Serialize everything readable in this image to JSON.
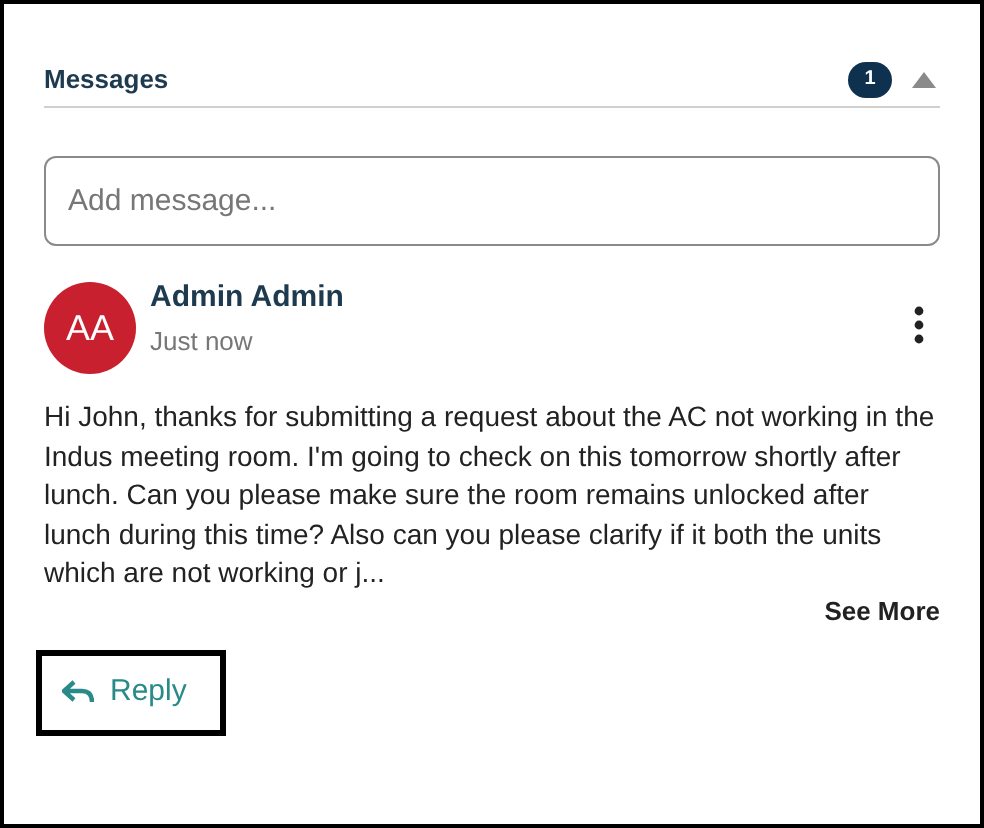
{
  "header": {
    "title": "Messages",
    "count": "1",
    "expanded": true
  },
  "composer": {
    "placeholder": "Add message..."
  },
  "message": {
    "initials": "AA",
    "author": "Admin Admin",
    "time": "Just now",
    "body": "Hi John, thanks for submitting a request about the AC not working in the Indus meeting room. I'm going to check on this tomorrow shortly after lunch. Can you please make sure the room remains unlocked after lunch during this time? Also can you please clarify if it both the units which are not working or j...",
    "see_more": "See More"
  },
  "reply": {
    "label": "Reply"
  }
}
